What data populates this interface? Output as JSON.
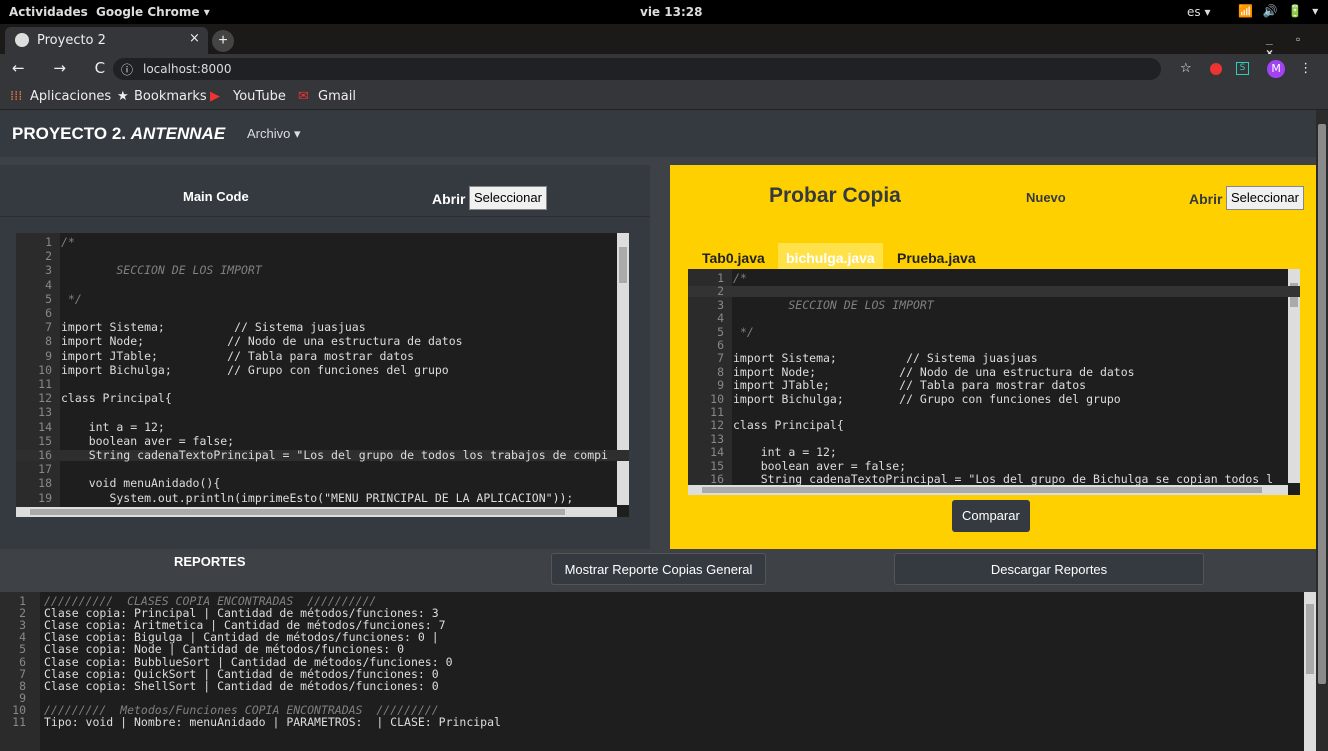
{
  "os_bar": {
    "activities": "Actividades",
    "app": "Google Chrome ▾",
    "clock": "vie 13:28",
    "lang": "es ▾",
    "system_icons": "📶 🔊 🔋 ▾"
  },
  "browser": {
    "tab_title": "Proyecto 2",
    "tab_close": "×",
    "new_tab": "+",
    "window_controls": "_ ▫ ×",
    "nav": "← → C ⌂",
    "url_info": "ⓘ",
    "url": "localhost:8000",
    "star": "☆",
    "ext2": "S",
    "avatar": "M",
    "menu": "⋮",
    "bookmarks": [
      "Aplicaciones",
      "Bookmarks",
      "YouTube",
      "Gmail"
    ]
  },
  "navbar": {
    "brand_main": "PROYECTO 2. ",
    "brand_em": "ANTENNAE",
    "menu": "Archivo ▾"
  },
  "main_code": {
    "title": "Main Code",
    "abrir": "Abrir",
    "seleccionar": "Seleccionar",
    "lines": [
      {
        "n": "1",
        "t": "/*",
        "cls": "c-com"
      },
      {
        "n": "2",
        "t": "",
        "cls": ""
      },
      {
        "n": "3",
        "t": "        SECCION DE LOS IMPORT",
        "cls": "c-com"
      },
      {
        "n": "4",
        "t": "",
        "cls": ""
      },
      {
        "n": "5",
        "t": " */",
        "cls": "c-com"
      },
      {
        "n": "6",
        "t": "",
        "cls": ""
      },
      {
        "n": "7",
        "t": "import Sistema;          // Sistema juasjuas",
        "cls": ""
      },
      {
        "n": "8",
        "t": "import Node;            // Nodo de una estructura de datos",
        "cls": ""
      },
      {
        "n": "9",
        "t": "import JTable;          // Tabla para mostrar datos",
        "cls": ""
      },
      {
        "n": "10",
        "t": "import Bichulga;        // Grupo con funciones del grupo",
        "cls": ""
      },
      {
        "n": "11",
        "t": "",
        "cls": ""
      },
      {
        "n": "12",
        "t": "class Principal{",
        "cls": ""
      },
      {
        "n": "13",
        "t": "",
        "cls": ""
      },
      {
        "n": "14",
        "t": "    int a = 12;",
        "cls": ""
      },
      {
        "n": "15",
        "t": "    boolean aver = false;",
        "cls": ""
      },
      {
        "n": "16",
        "t": "    String cadenaTextoPrincipal = \"Los del grupo de todos los trabajos de compi",
        "cls": "hl"
      },
      {
        "n": "17",
        "t": "",
        "cls": ""
      },
      {
        "n": "18",
        "t": "    void menuAnidado(){",
        "cls": ""
      },
      {
        "n": "19",
        "t": "       System.out.println(imprimeEsto(\"MENU PRINCIPAL DE LA APLICACION\"));",
        "cls": ""
      }
    ]
  },
  "probar": {
    "title": "Probar Copia",
    "nuevo": "Nuevo",
    "abrir": "Abrir",
    "seleccionar": "Seleccionar",
    "tabs": [
      "Tab0.java",
      "bichulga.java",
      "Prueba.java"
    ],
    "comparar": "Comparar",
    "lines": [
      {
        "n": "1",
        "t": "/*",
        "cls": "c-com"
      },
      {
        "n": "2",
        "t": "",
        "cls": "cur"
      },
      {
        "n": "3",
        "t": "        SECCION DE LOS IMPORT",
        "cls": "c-com"
      },
      {
        "n": "4",
        "t": "",
        "cls": ""
      },
      {
        "n": "5",
        "t": " */",
        "cls": "c-com"
      },
      {
        "n": "6",
        "t": "",
        "cls": ""
      },
      {
        "n": "7",
        "t": "import Sistema;          // Sistema juasjuas",
        "cls": ""
      },
      {
        "n": "8",
        "t": "import Node;            // Nodo de una estructura de datos",
        "cls": ""
      },
      {
        "n": "9",
        "t": "import JTable;          // Tabla para mostrar datos",
        "cls": ""
      },
      {
        "n": "10",
        "t": "import Bichulga;        // Grupo con funciones del grupo",
        "cls": ""
      },
      {
        "n": "11",
        "t": "",
        "cls": ""
      },
      {
        "n": "12",
        "t": "class Principal{",
        "cls": ""
      },
      {
        "n": "13",
        "t": "",
        "cls": ""
      },
      {
        "n": "14",
        "t": "    int a = 12;",
        "cls": ""
      },
      {
        "n": "15",
        "t": "    boolean aver = false;",
        "cls": ""
      },
      {
        "n": "16",
        "t": "    String cadenaTextoPrincipal = \"Los del grupo de Bichulga se copian todos l",
        "cls": ""
      }
    ]
  },
  "reportes": {
    "title": "REPORTES",
    "mostrar": "Mostrar Reporte Copias General",
    "descargar": "Descargar Reportes",
    "lines": [
      {
        "n": "1",
        "t": "//////////  CLASES COPIA ENCONTRADAS  //////////",
        "cls": "c-com"
      },
      {
        "n": "2",
        "t": "Clase copia: Principal | Cantidad de métodos/funciones: 3",
        "cls": ""
      },
      {
        "n": "3",
        "t": "Clase copia: Aritmetica | Cantidad de métodos/funciones: 7",
        "cls": ""
      },
      {
        "n": "4",
        "t": "Clase copia: Bigulga | Cantidad de métodos/funciones: 0 |",
        "cls": "hl"
      },
      {
        "n": "5",
        "t": "Clase copia: Node | Cantidad de métodos/funciones: 0",
        "cls": ""
      },
      {
        "n": "6",
        "t": "Clase copia: BubblueSort | Cantidad de métodos/funciones: 0",
        "cls": ""
      },
      {
        "n": "7",
        "t": "Clase copia: QuickSort | Cantidad de métodos/funciones: 0",
        "cls": ""
      },
      {
        "n": "8",
        "t": "Clase copia: ShellSort | Cantidad de métodos/funciones: 0",
        "cls": ""
      },
      {
        "n": "9",
        "t": "",
        "cls": ""
      },
      {
        "n": "10",
        "t": "/////////  Metodos/Funciones COPIA ENCONTRADAS  /////////",
        "cls": "c-com"
      },
      {
        "n": "11",
        "t": "Tipo: void | Nombre: menuAnidado | PARAMETROS:  | CLASE: Principal",
        "cls": ""
      }
    ]
  },
  "colors": {
    "accent": "#ffd000",
    "dark": "#343a40",
    "editor_bg": "#1e1e1e"
  }
}
